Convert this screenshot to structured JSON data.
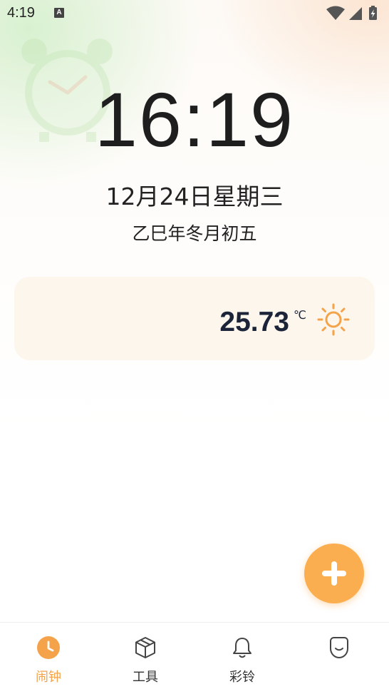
{
  "status_bar": {
    "time": "4:19",
    "notification_badge": "A"
  },
  "clock": {
    "time": "16:19",
    "date": "12月24日星期三",
    "lunar_date": "乙巳年冬月初五"
  },
  "weather": {
    "temperature": "25.73",
    "unit": "℃",
    "icon": "sun-icon"
  },
  "fab": {
    "icon": "plus-icon"
  },
  "bottom_nav": {
    "items": [
      {
        "label": "闹钟",
        "icon": "clock-icon",
        "active": true
      },
      {
        "label": "工具",
        "icon": "box-icon",
        "active": false
      },
      {
        "label": "彩铃",
        "icon": "bell-icon",
        "active": false
      },
      {
        "label": "",
        "icon": "profile-icon",
        "active": false
      }
    ]
  },
  "colors": {
    "accent": "#f5a34a",
    "fab": "#fbae4f",
    "weather_card": "#fdf6ec",
    "text_dark": "#1c2439"
  }
}
